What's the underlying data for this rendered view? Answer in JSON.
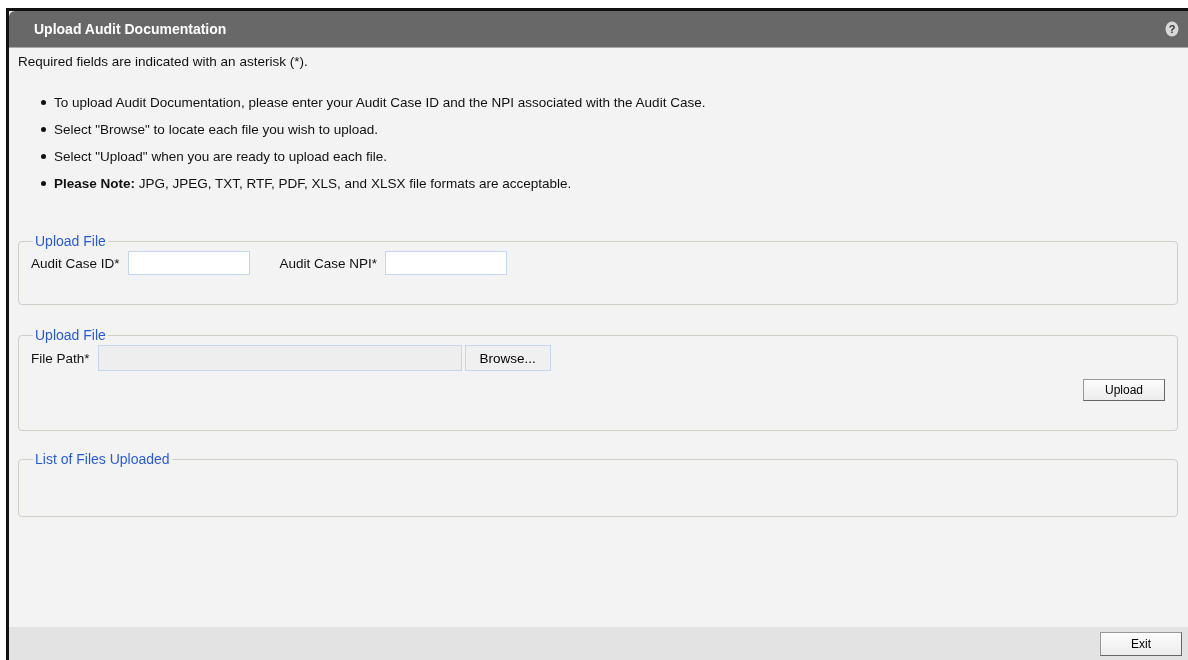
{
  "window": {
    "title": "Upload Audit Documentation",
    "help": "?"
  },
  "required_note": "Required fields are indicated with an asterisk (*).",
  "instructions": [
    "To upload Audit Documentation, please enter your Audit Case ID and the NPI associated with the Audit Case.",
    "Select \"Browse\" to locate each file you wish to upload.",
    "Select \"Upload\" when you are ready to upload each file.",
    "**Please Note:** JPG, JPEG, TXT, RTF, PDF, XLS, and XLSX file formats are acceptable."
  ],
  "case_section": {
    "legend": "Upload File",
    "fields": [
      {
        "label": "Audit Case ID*"
      },
      {
        "label": "Audit Case NPI*"
      }
    ]
  },
  "file_section": {
    "legend": "Upload File",
    "file_path": {
      "label": "File Path*",
      "disabled": true
    },
    "browse_button": "Browse...",
    "upload_button": "Upload"
  },
  "files_section": {
    "legend": "List of Files Uploaded"
  },
  "footer": {
    "exit_button": "Exit"
  }
}
